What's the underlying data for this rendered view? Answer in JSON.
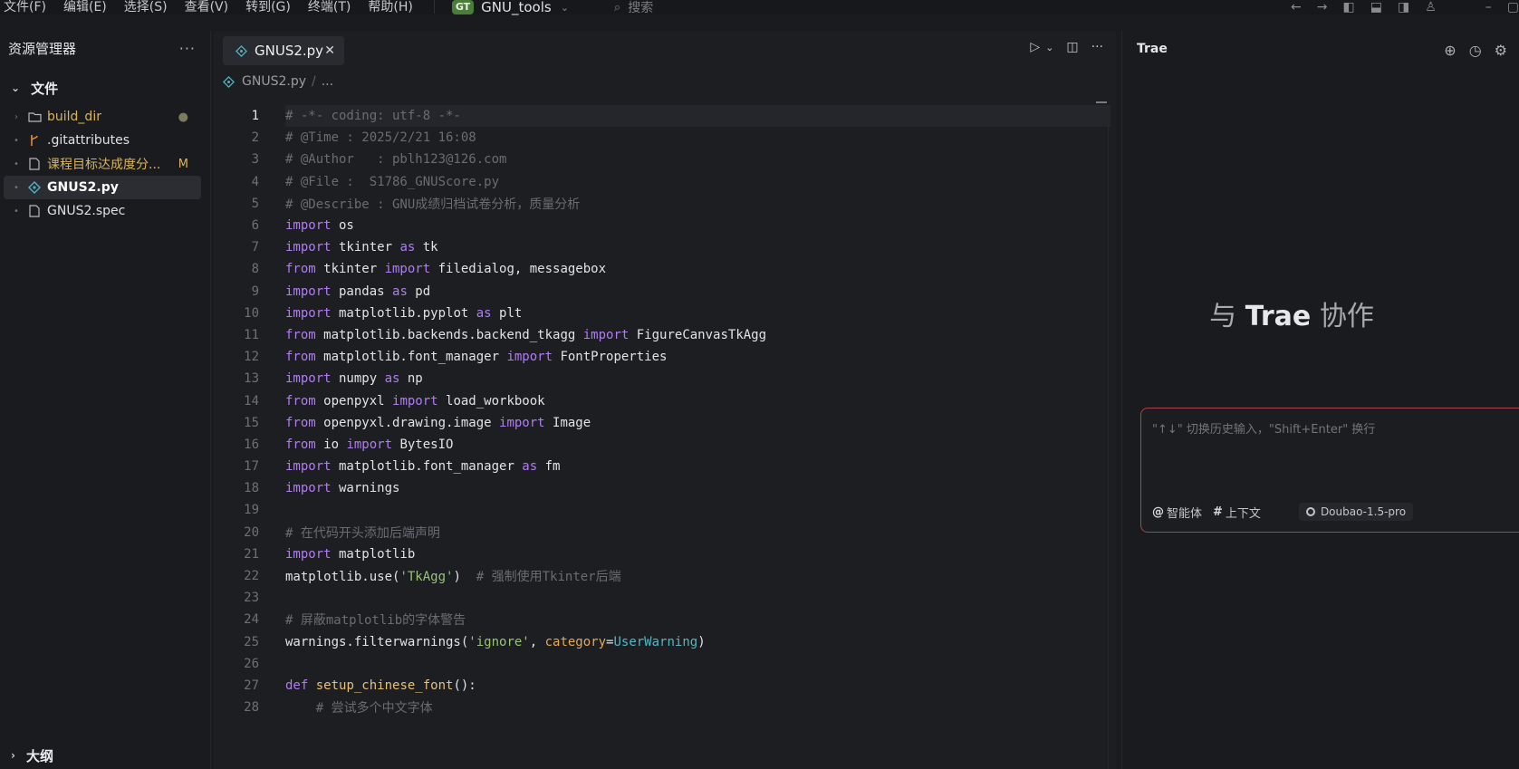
{
  "menu": [
    "文件(F)",
    "编辑(E)",
    "选择(S)",
    "查看(V)",
    "转到(G)",
    "终端(T)",
    "帮助(H)"
  ],
  "workspace": {
    "badge": "GT",
    "name": "GNU_tools"
  },
  "search": {
    "placeholder": "搜索"
  },
  "explorer": {
    "title": "资源管理器",
    "section": "文件",
    "items": [
      {
        "label": "build_dir",
        "type": "folder",
        "status": "●",
        "color": "#d9b45b"
      },
      {
        "label": ".gitattributes",
        "type": "git",
        "status": "",
        "color": "#e0e0e4"
      },
      {
        "label": "课程目标达成度分...",
        "type": "file",
        "status": "M",
        "color": "#d9b45b"
      },
      {
        "label": "GNUS2.py",
        "type": "python",
        "status": "",
        "color": "#ffffff"
      },
      {
        "label": "GNUS2.spec",
        "type": "file",
        "status": "",
        "color": "#e0e0e4"
      }
    ],
    "outline": "大纲"
  },
  "editor": {
    "tab": "GNUS2.py",
    "breadcrumb": {
      "file": "GNUS2.py",
      "rest": "..."
    },
    "current_line": 1,
    "lines": [
      [
        [
          "cm",
          "# -*- coding: utf-8 -*-"
        ]
      ],
      [
        [
          "cm",
          "# @Time : 2025/2/21 16:08"
        ]
      ],
      [
        [
          "cm",
          "# @Author   : pblh123@126.com"
        ]
      ],
      [
        [
          "cm",
          "# @File :  S1786_GNUScore.py"
        ]
      ],
      [
        [
          "cm",
          "# @Describe : GNU成绩归档试卷分析，质量分析"
        ]
      ],
      [
        [
          "kw",
          "import"
        ],
        [
          "pl",
          " os"
        ]
      ],
      [
        [
          "kw",
          "import"
        ],
        [
          "pl",
          " tkinter "
        ],
        [
          "kw",
          "as"
        ],
        [
          "pl",
          " tk"
        ]
      ],
      [
        [
          "kw",
          "from"
        ],
        [
          "pl",
          " tkinter "
        ],
        [
          "kw",
          "import"
        ],
        [
          "pl",
          " filedialog, messagebox"
        ]
      ],
      [
        [
          "kw",
          "import"
        ],
        [
          "pl",
          " pandas "
        ],
        [
          "kw",
          "as"
        ],
        [
          "pl",
          " pd"
        ]
      ],
      [
        [
          "kw",
          "import"
        ],
        [
          "pl",
          " matplotlib.pyplot "
        ],
        [
          "kw",
          "as"
        ],
        [
          "pl",
          " plt"
        ]
      ],
      [
        [
          "kw",
          "from"
        ],
        [
          "pl",
          " matplotlib.backends.backend_tkagg "
        ],
        [
          "kw",
          "import"
        ],
        [
          "pl",
          " FigureCanvasTkAgg"
        ]
      ],
      [
        [
          "kw",
          "from"
        ],
        [
          "pl",
          " matplotlib.font_manager "
        ],
        [
          "kw",
          "import"
        ],
        [
          "pl",
          " FontProperties"
        ]
      ],
      [
        [
          "kw",
          "import"
        ],
        [
          "pl",
          " numpy "
        ],
        [
          "kw",
          "as"
        ],
        [
          "pl",
          " np"
        ]
      ],
      [
        [
          "kw",
          "from"
        ],
        [
          "pl",
          " openpyxl "
        ],
        [
          "kw",
          "import"
        ],
        [
          "pl",
          " load_workbook"
        ]
      ],
      [
        [
          "kw",
          "from"
        ],
        [
          "pl",
          " openpyxl.drawing.image "
        ],
        [
          "kw",
          "import"
        ],
        [
          "pl",
          " Image"
        ]
      ],
      [
        [
          "kw",
          "from"
        ],
        [
          "pl",
          " io "
        ],
        [
          "kw",
          "import"
        ],
        [
          "pl",
          " BytesIO"
        ]
      ],
      [
        [
          "kw",
          "import"
        ],
        [
          "pl",
          " matplotlib.font_manager "
        ],
        [
          "kw",
          "as"
        ],
        [
          "pl",
          " fm"
        ]
      ],
      [
        [
          "kw",
          "import"
        ],
        [
          "pl",
          " warnings"
        ]
      ],
      [],
      [
        [
          "cm",
          "# 在代码开头添加后端声明"
        ]
      ],
      [
        [
          "kw",
          "import"
        ],
        [
          "pl",
          " matplotlib"
        ]
      ],
      [
        [
          "pl",
          "matplotlib.use("
        ],
        [
          "str",
          "'TkAgg'"
        ],
        [
          "pl",
          ")  "
        ],
        [
          "cm",
          "# 强制使用Tkinter后端"
        ]
      ],
      [],
      [
        [
          "cm",
          "# 屏蔽matplotlib的字体警告"
        ]
      ],
      [
        [
          "pl",
          "warnings.filterwarnings("
        ],
        [
          "str",
          "'ignore'"
        ],
        [
          "pl",
          ", "
        ],
        [
          "param",
          "category"
        ],
        [
          "pl",
          "="
        ],
        [
          "cls",
          "UserWarning"
        ],
        [
          "pl",
          ")"
        ]
      ],
      [],
      [
        [
          "kw",
          "def"
        ],
        [
          "pl",
          " "
        ],
        [
          "fn",
          "setup_chinese_font"
        ],
        [
          "pl",
          "():"
        ]
      ],
      [
        [
          "pl",
          "    "
        ],
        [
          "cm",
          "# 尝试多个中文字体"
        ]
      ]
    ]
  },
  "right_panel": {
    "title": "Trae",
    "collab_prefix": "与",
    "collab_brand": "Trae",
    "collab_suffix": "协作",
    "input_placeholder": "\"↑↓\" 切换历史输入，\"Shift+Enter\" 换行",
    "agent_label": "智能体",
    "context_label": "上下文",
    "model": "Doubao-1.5-pro"
  }
}
